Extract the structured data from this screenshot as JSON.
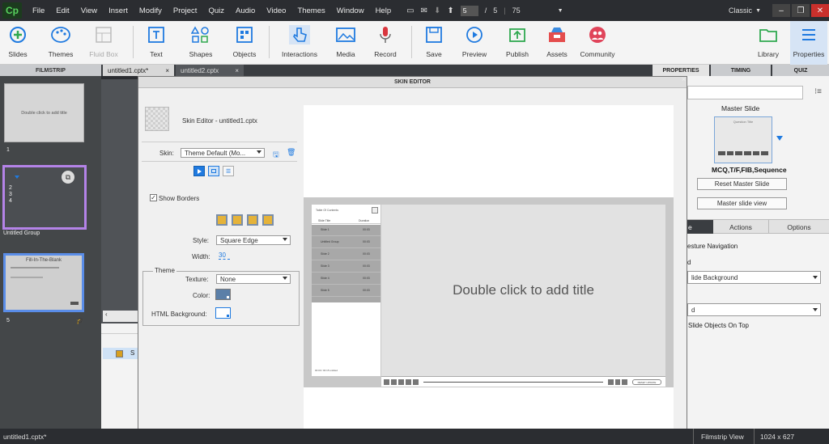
{
  "menubar": {
    "logo": "Cp",
    "items": [
      "File",
      "Edit",
      "View",
      "Insert",
      "Modify",
      "Project",
      "Quiz",
      "Audio",
      "Video",
      "Themes",
      "Window",
      "Help"
    ],
    "current_slide": "5",
    "slide_sep": "/",
    "total_slides": "5",
    "zoom": "75",
    "workspace": "Classic"
  },
  "toolbar": {
    "slides": "Slides",
    "themes": "Themes",
    "fluid_box": "Fluid Box",
    "text": "Text",
    "shapes": "Shapes",
    "objects": "Objects",
    "interactions": "Interactions",
    "media": "Media",
    "record": "Record",
    "save": "Save",
    "preview": "Preview",
    "publish": "Publish",
    "assets": "Assets",
    "community": "Community",
    "library": "Library",
    "properties": "Properties"
  },
  "tabs": {
    "filmstrip": "FILMSTRIP",
    "doc1": "untitled1.cptx*",
    "doc2": "untitled2.cptx",
    "close": "×",
    "properties": "PROPERTIES",
    "timing": "TIMING",
    "quiz": "QUIZ"
  },
  "filmstrip": {
    "slide1_text": "Double click to add title",
    "slide1_num": "1",
    "group_nums": [
      "2",
      "3",
      "4"
    ],
    "group_label": "Untitled Group",
    "slide5_title": "Fill-In-The-Blank",
    "slide5_num": "5"
  },
  "dialog": {
    "title": "SKIN EDITOR",
    "header": "Skin Editor - untitled1.cptx",
    "skin_label": "Skin:",
    "skin_value": "Theme Default (Mo...",
    "show_borders": "Show Borders",
    "style_label": "Style:",
    "style_value": "Square Edge",
    "width_label": "Width:",
    "width_value": "30",
    "theme_legend": "Theme",
    "texture_label": "Texture:",
    "texture_value": "None",
    "color_label": "Color:",
    "html_bg_label": "HTML Background:"
  },
  "preview": {
    "toc_title": "Table Of Contents",
    "col_title": "Slide Title",
    "col_duration": "Duration",
    "rows": [
      {
        "title": "Slide 1",
        "dur": "00:03"
      },
      {
        "title": "Untitled Group",
        "dur": "00:03"
      },
      {
        "title": "Slide 2",
        "dur": "00:03"
      },
      {
        "title": "Slide 3",
        "dur": "00:03"
      },
      {
        "title": "Slide 4",
        "dur": "00:03"
      },
      {
        "title": "Slide 5",
        "dur": "00:03"
      }
    ],
    "slide_title": "Double click to add title",
    "footer_left": "00:00 / 00:15 untitled",
    "footer_btn": "RESET UPDATE"
  },
  "right": {
    "master_slide_label": "Master Slide",
    "master_thumb_title": "Question Title",
    "master_name": "MCQ,T/F,FIB,Sequence",
    "reset_master": "Reset Master Slide",
    "master_view": "Master slide view",
    "tab_style": "e",
    "tab_actions": "Actions",
    "tab_options": "Options",
    "gesture": "esture Navigation",
    "d1": "d",
    "bg_select": "lide Background",
    "d2": "d",
    "objects_on_top": "Slide Objects On Top"
  },
  "status": {
    "file": "untitled1.cptx*",
    "view": "Filmstrip View",
    "dims": "1024 x 627"
  },
  "colors": {
    "accent": "#1f7ae0",
    "dark": "#2b2d31",
    "group_border": "#b483e8",
    "selected_border": "#5a8de8"
  }
}
